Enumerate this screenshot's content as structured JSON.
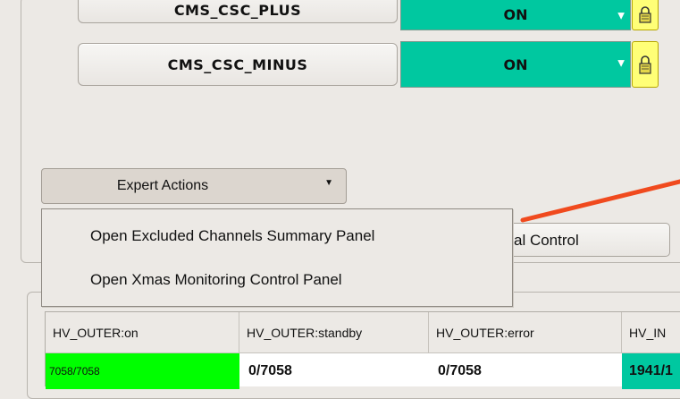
{
  "partitions": [
    {
      "name": "CMS_CSC_PLUS",
      "state": "ON"
    },
    {
      "name": "CMS_CSC_MINUS",
      "state": "ON"
    }
  ],
  "expert_actions": {
    "label": "Expert Actions"
  },
  "background_button": {
    "label": "al Control"
  },
  "menu": {
    "items": [
      "Open Excluded Channels Summary Panel",
      "Open Xmas Monitoring Control Panel"
    ]
  },
  "table": {
    "headers": [
      "HV_OUTER:on",
      "HV_OUTER:standby",
      "HV_OUTER:error",
      "HV_IN"
    ],
    "row": [
      "7058/7058",
      "0/7058",
      "0/7058",
      "1941/1"
    ]
  },
  "colors": {
    "state_on": "#00c8a0",
    "lock": "#ffff77",
    "ok_cell": "#00ff00",
    "annotation": "#f04a1e"
  },
  "icons": [
    "lock-icon",
    "chevron-down-icon"
  ]
}
